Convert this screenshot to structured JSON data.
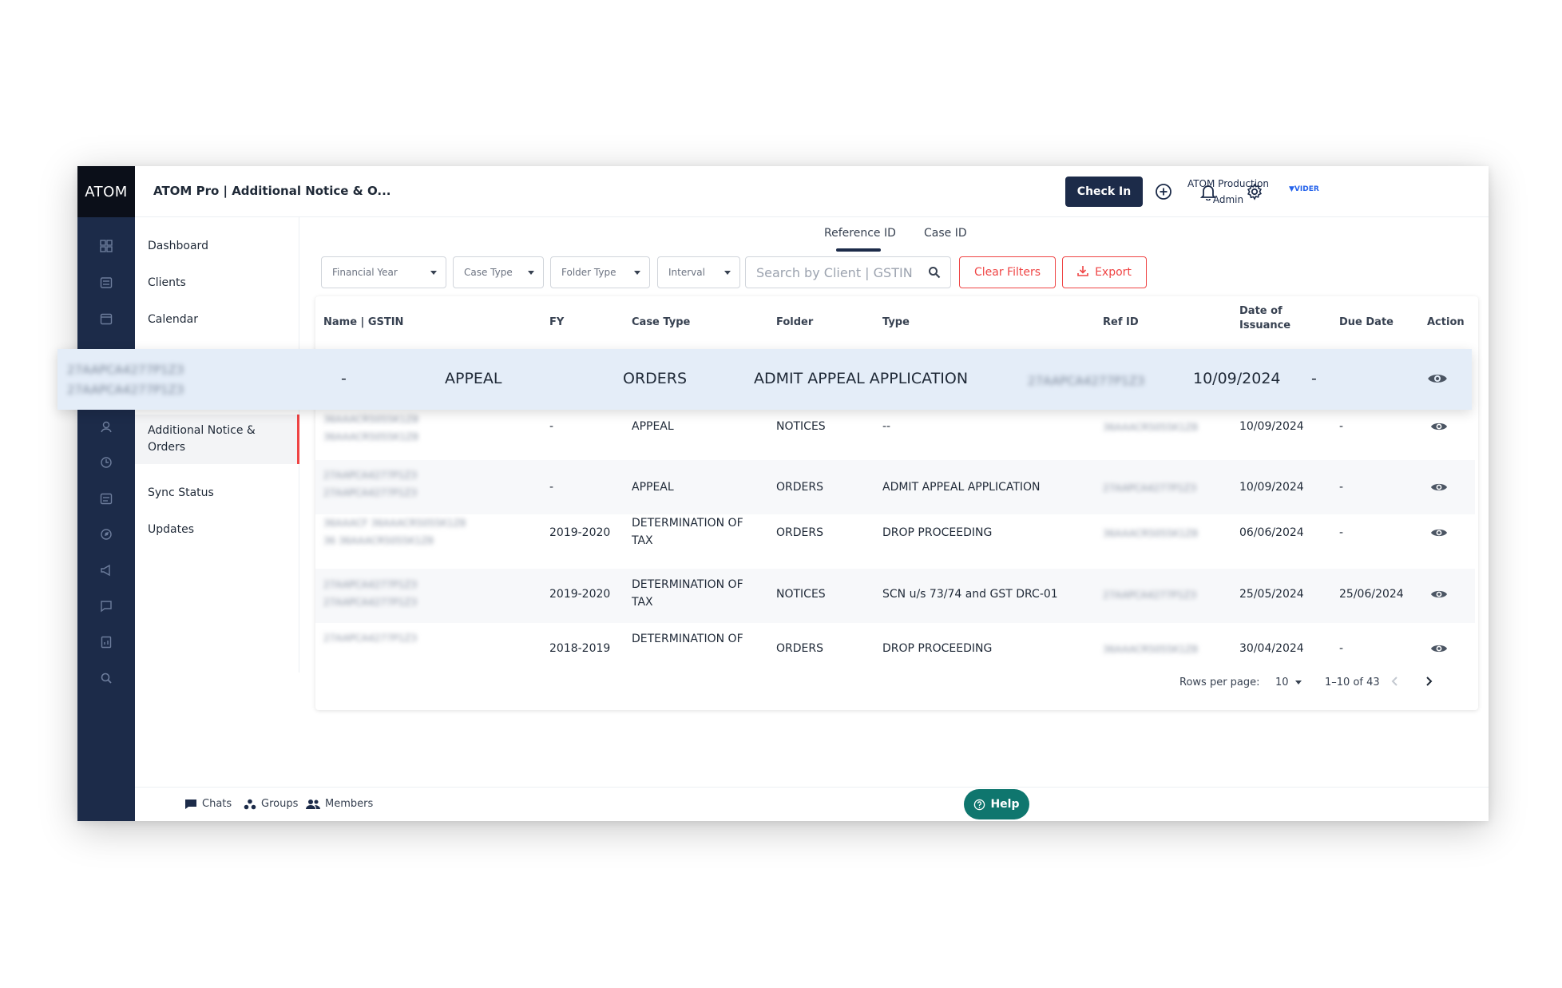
{
  "app": {
    "brand": "ATOM",
    "page_title": "ATOM Pro | Additional Notice & O...",
    "checkin_label": "Check In",
    "user_line1": "ATOM Production",
    "user_line2": "Admin",
    "partner_logo": "VIDER"
  },
  "nav": {
    "items": [
      "Dashboard",
      "Clients",
      "Calendar"
    ],
    "active_line1": "Additional Notice &",
    "active_line2": "Orders",
    "lower_items": [
      "Sync Status",
      "Updates"
    ]
  },
  "tabs": [
    "Reference ID",
    "Case ID"
  ],
  "filters": {
    "financial_year": "Financial Year",
    "case_type": "Case Type",
    "folder_type": "Folder Type",
    "interval": "Interval",
    "search_placeholder": "Search by Client | GSTIN",
    "clear_label": "Clear Filters",
    "export_label": "Export"
  },
  "table": {
    "headers": {
      "name": "Name | GSTIN",
      "fy": "FY",
      "case_type": "Case Type",
      "folder": "Folder",
      "type": "Type",
      "ref_id": "Ref ID",
      "issuance_1": "Date of",
      "issuance_2": "Issuance",
      "due": "Due Date",
      "action": "Action"
    },
    "highlight": {
      "name_1": "27AAPCA4277P1Z3",
      "name_2": "27AAPCA4277P1Z3",
      "fy": "-",
      "case_type": "APPEAL",
      "folder": "ORDERS",
      "type": "ADMIT APPEAL APPLICATION",
      "ref_id": "27AAPCA4277P1Z3",
      "issuance": "10/09/2024",
      "due": "-"
    },
    "rows": [
      {
        "name_1": "36AAACR5055K1Z8",
        "name_2": "36AAACR5055K1Z8",
        "fy": "-",
        "case_1": "APPEAL",
        "case_2": "",
        "folder": "NOTICES",
        "type": "--",
        "ref_id": "36AAACR5055K1Z8",
        "issuance": "10/09/2024",
        "due": "-"
      },
      {
        "name_1": "27AAPCA4277P1Z3",
        "name_2": "27AAPCA4277P1Z3",
        "fy": "-",
        "case_1": "APPEAL",
        "case_2": "",
        "folder": "ORDERS",
        "type": "ADMIT APPEAL APPLICATION",
        "ref_id": "27AAPCA4277P1Z3",
        "issuance": "10/09/2024",
        "due": "-"
      },
      {
        "name_1": "36AAACF 36AAACR5055K1Z8",
        "name_2": "36 36AAACR5055K1Z8",
        "fy": "2019-2020",
        "case_1": "DETERMINATION OF",
        "case_2": "TAX",
        "folder": "ORDERS",
        "type": "DROP PROCEEDING",
        "ref_id": "36AAACR5055K1Z8",
        "issuance": "06/06/2024",
        "due": "-"
      },
      {
        "name_1": "27AAPCA4277P1Z3",
        "name_2": "27AAPCA4277P1Z3",
        "fy": "2019-2020",
        "case_1": "DETERMINATION OF",
        "case_2": "TAX",
        "folder": "NOTICES",
        "type": "SCN u/s 73/74 and GST DRC-01",
        "ref_id": "27AAPCA4277P1Z3",
        "issuance": "25/05/2024",
        "due": "25/06/2024"
      },
      {
        "name_1": "27AAPCA4277P1Z3",
        "name_2": "",
        "fy": "2018-2019",
        "case_1": "DETERMINATION OF",
        "case_2": "",
        "folder": "ORDERS",
        "type": "DROP PROCEEDING",
        "ref_id": "36AAACR5055K1Z8",
        "issuance": "30/04/2024",
        "due": "-"
      }
    ]
  },
  "pagination": {
    "rows_label": "Rows per page:",
    "rows_value": "10",
    "range": "1–10 of 43"
  },
  "footer": {
    "chats": "Chats",
    "groups": "Groups",
    "members": "Members",
    "help": "Help"
  },
  "colors": {
    "navy": "#1c2b49",
    "accent_red": "#ef4444",
    "help_green": "#0f766e",
    "highlight_row": "#e4edf8"
  }
}
